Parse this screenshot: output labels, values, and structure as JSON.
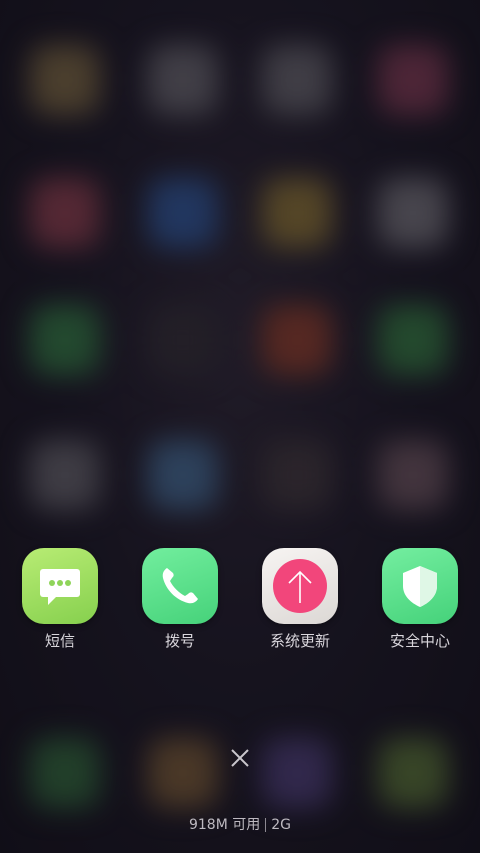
{
  "recent_apps": [
    {
      "label": "短信",
      "icon": "message-bubble-icon",
      "color": "#9ADF5E"
    },
    {
      "label": "拨号",
      "icon": "phone-handset-icon",
      "color": "#5EE08C"
    },
    {
      "label": "系统更新",
      "icon": "upload-arrow-icon",
      "color": "#F0447A"
    },
    {
      "label": "安全中心",
      "icon": "shield-icon",
      "color": "#5EE08C"
    }
  ],
  "close_button": {
    "icon": "close-x-icon"
  },
  "memory": {
    "available": "918M 可用",
    "total": "2G"
  }
}
